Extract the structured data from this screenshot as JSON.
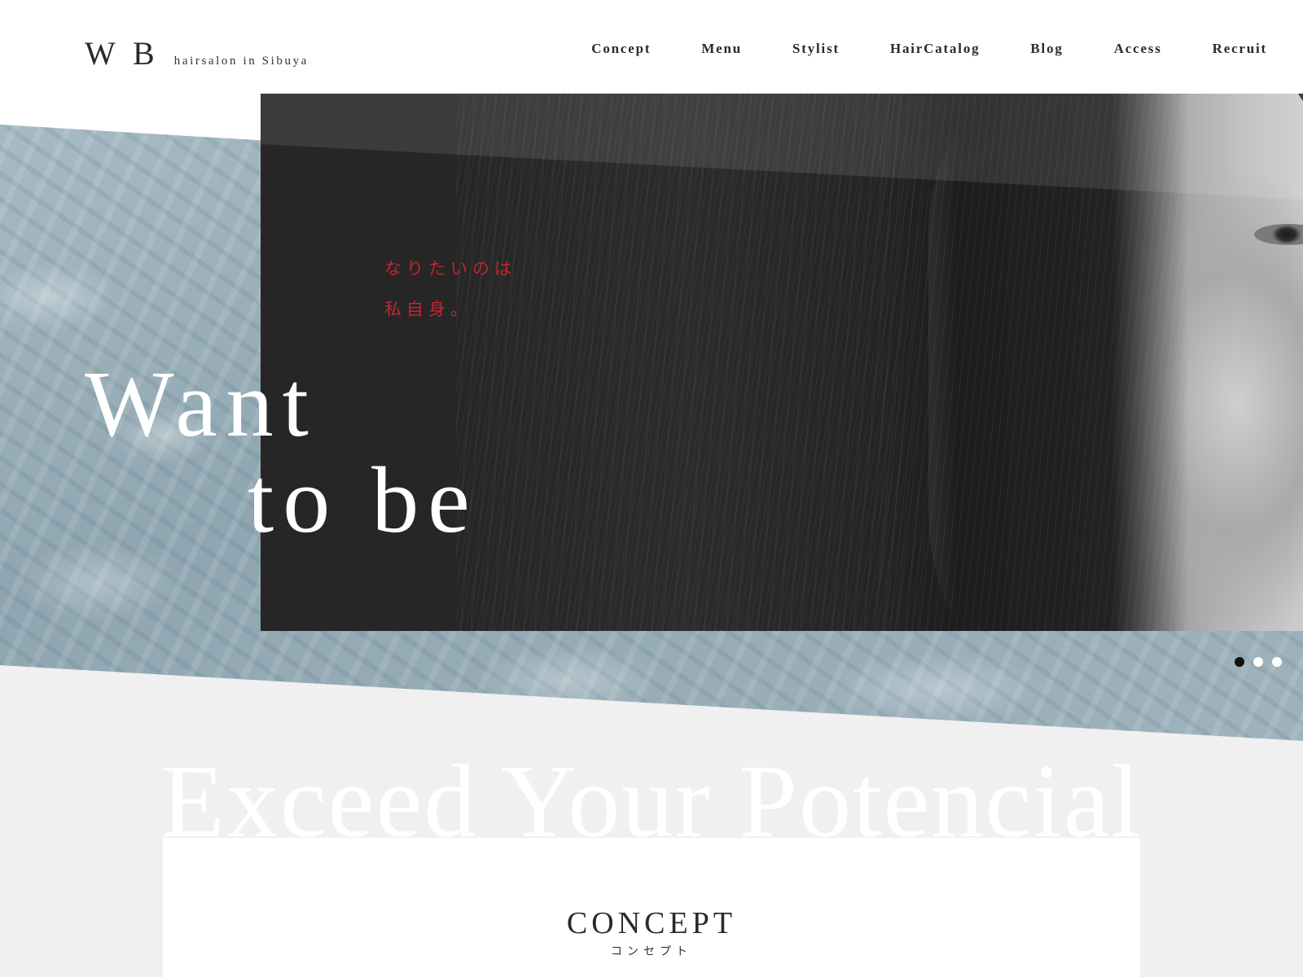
{
  "brand": {
    "logo_text": "W B",
    "tagline": "hairsalon in Sibuya"
  },
  "nav": {
    "items": [
      {
        "label": "Concept"
      },
      {
        "label": "Menu"
      },
      {
        "label": "Stylist"
      },
      {
        "label": "HairCatalog"
      },
      {
        "label": "Blog"
      },
      {
        "label": "Access"
      },
      {
        "label": "Recruit"
      }
    ]
  },
  "hero": {
    "catch_jp_line1": "なりたいのは",
    "catch_jp_line2": "私自身。",
    "headline_line1": "Want",
    "headline_line2": "to be",
    "slides_total": 3,
    "active_slide": 1
  },
  "concept": {
    "background_tagline": "Exceed Your Potencial",
    "title": "CONCEPT",
    "subtitle": "コンセプト"
  },
  "colors": {
    "accent_red": "#c0272d",
    "text_dark": "#2a2a2a",
    "section_gray": "#f0f0f0",
    "water_blue": "#9fb3bd"
  }
}
